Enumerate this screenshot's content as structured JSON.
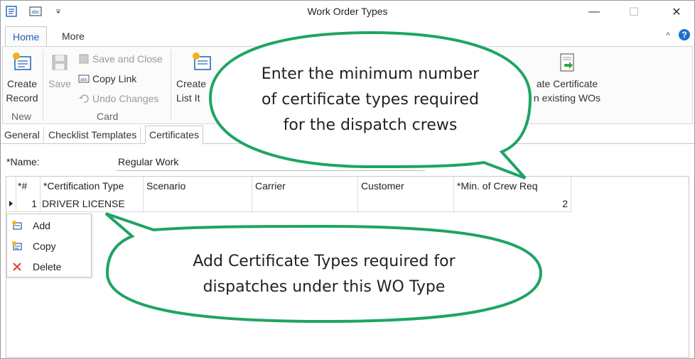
{
  "window": {
    "title": "Work Order Types",
    "minimize_glyph": "—",
    "maximize_glyph": "☐",
    "close_glyph": "✕"
  },
  "ribbon": {
    "tabs": [
      {
        "label": "Home",
        "active": true
      },
      {
        "label": "More",
        "active": false
      }
    ],
    "collapse_glyph": "^",
    "help_glyph": "?",
    "new_group": {
      "label": "New",
      "create_record": "Create\nRecord"
    },
    "card_group": {
      "label": "Card",
      "save": "Save",
      "save_and_close": "Save and Close",
      "copy_link": "Copy Link",
      "undo_changes": "Undo Changes"
    },
    "create_list_item": "Create\nList It",
    "create_certificate": "ate Certificate\nn existing WOs"
  },
  "form": {
    "tabs": [
      {
        "label": "General",
        "active": false
      },
      {
        "label": "Checklist Templates",
        "active": false
      },
      {
        "label": "Certificates",
        "active": true
      }
    ],
    "name_label": "*Name:",
    "name_value": "Regular Work"
  },
  "grid": {
    "columns": [
      "*#",
      "*Certification Type",
      "Scenario",
      "Carrier",
      "Customer",
      "*Min. of Crew Req"
    ],
    "rows": [
      {
        "num": "1",
        "certification_type": "DRIVER LICENSE",
        "scenario": "",
        "carrier": "",
        "customer": "",
        "min_crew": "2"
      }
    ]
  },
  "context_menu": {
    "items": [
      {
        "label": "Add",
        "icon": "add-icon"
      },
      {
        "label": "Copy",
        "icon": "copy-icon"
      },
      {
        "label": "Delete",
        "icon": "delete-icon"
      }
    ]
  },
  "callouts": {
    "top_text": "Enter the minimum number\nof certificate types required\nfor the dispatch crews",
    "bottom_text": "Add Certificate Types required for\ndispatches under this WO Type",
    "border_color": "#1fa463"
  }
}
